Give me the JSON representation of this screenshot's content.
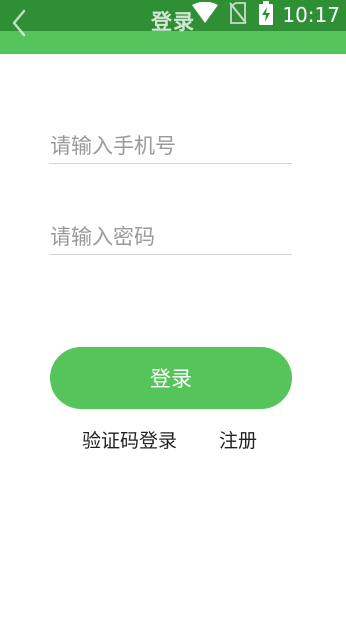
{
  "header": {
    "title": "登录",
    "back_icon": "chevron-left-icon"
  },
  "status_bar": {
    "time": "10:17",
    "icons": [
      "wifi-icon",
      "no-sim-icon",
      "battery-charging-icon"
    ]
  },
  "form": {
    "phone_placeholder": "请输入手机号",
    "phone_value": "",
    "password_placeholder": "请输入密码",
    "password_value": "",
    "login_button_label": "登录"
  },
  "links": {
    "sms_login": "验证码登录",
    "register": "注册"
  },
  "colors": {
    "accent": "#55c45a",
    "status_bar": "#2f8f35",
    "text": "#222222",
    "placeholder": "#9a9a9a",
    "divider": "#d4d4d4"
  }
}
